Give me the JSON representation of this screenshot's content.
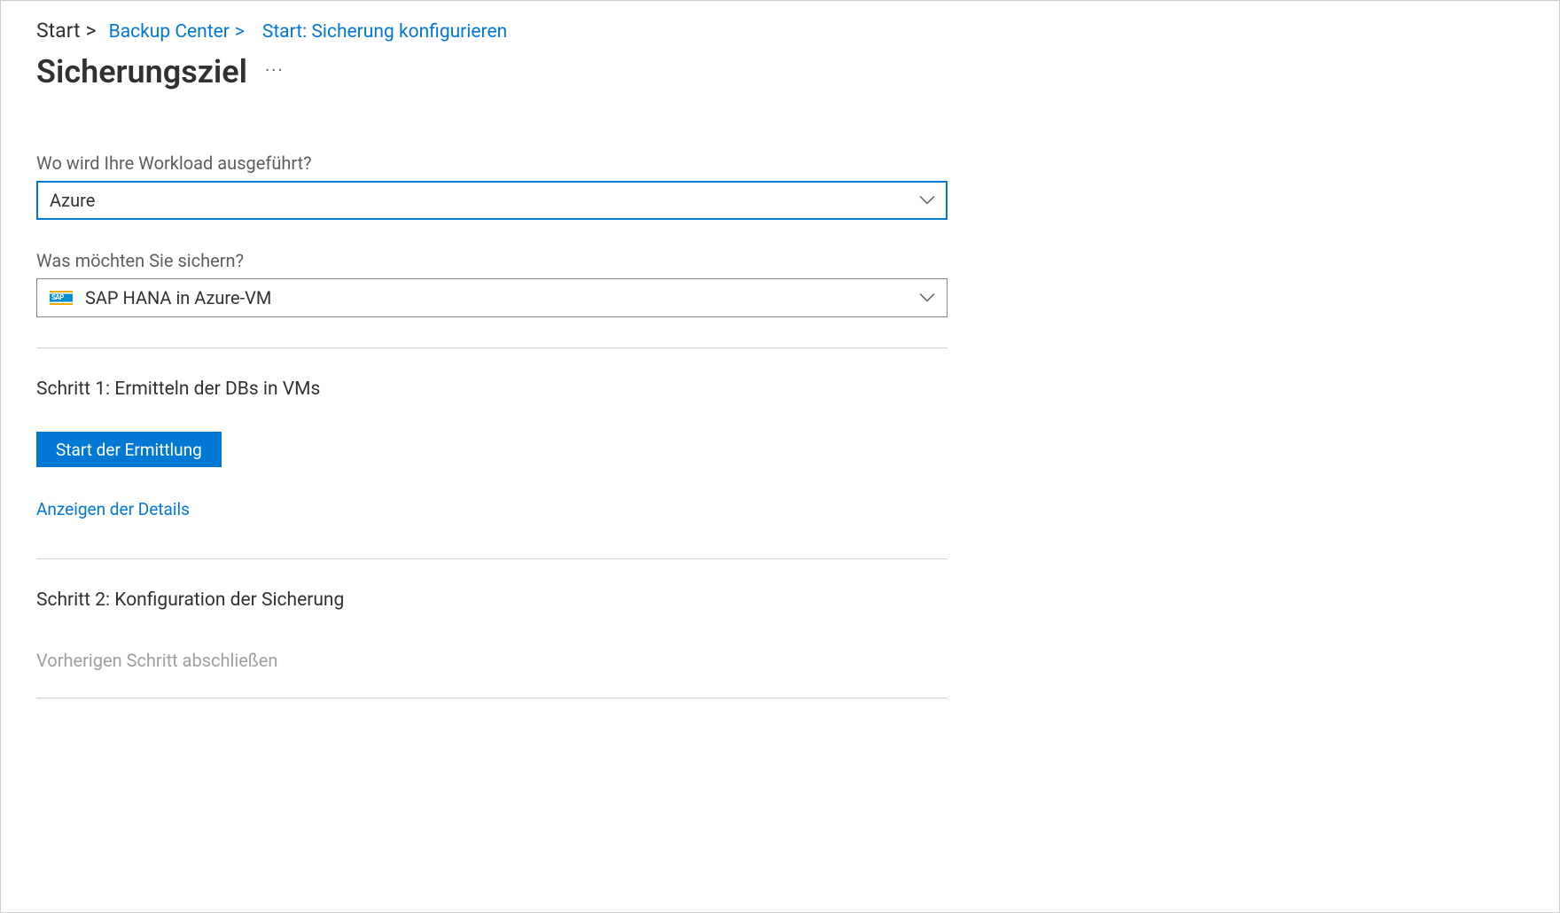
{
  "breadcrumb": {
    "start": "Start",
    "sep": ">",
    "items": [
      {
        "label": "Backup Center",
        "sep": ">"
      },
      {
        "label": "Start: Sicherung konfigurieren",
        "sep": ""
      }
    ]
  },
  "page": {
    "title": "Sicherungsziel",
    "more": "···"
  },
  "form": {
    "workload_label": "Wo wird Ihre Workload ausgeführt?",
    "workload_value": "Azure",
    "backup_label": "Was möchten Sie sichern?",
    "backup_value": "SAP HANA in Azure-VM"
  },
  "step1": {
    "title": "Schritt 1: Ermitteln der DBs in VMs",
    "button": "Start der Ermittlung",
    "details_link": "Anzeigen der Details"
  },
  "step2": {
    "title": "Schritt 2: Konfiguration der Sicherung",
    "note": "Vorherigen Schritt abschließen"
  }
}
